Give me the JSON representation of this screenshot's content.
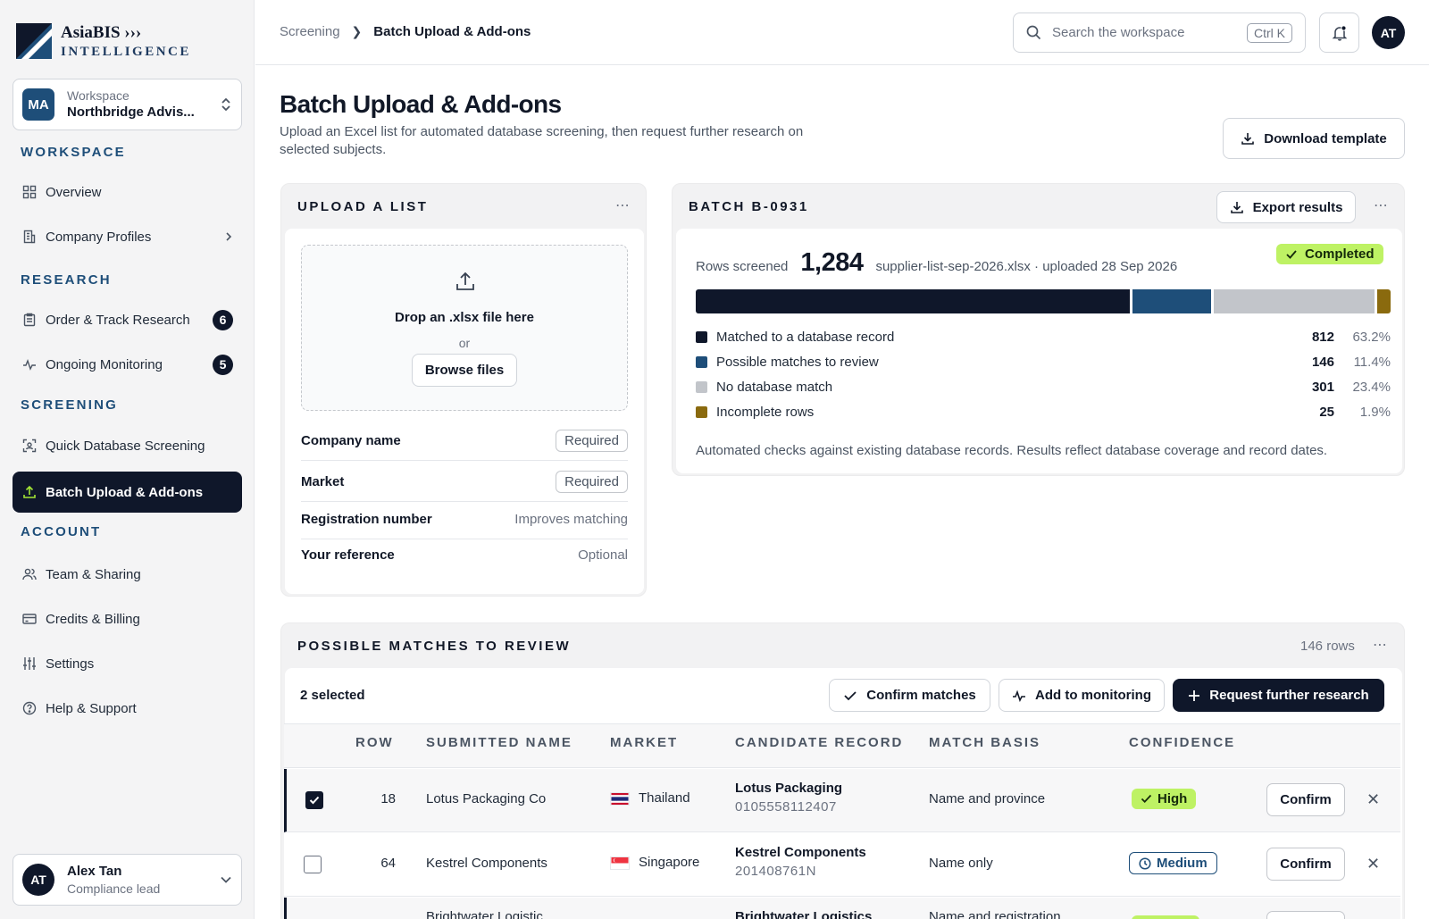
{
  "brand": {
    "name": "AsiaBIS",
    "chevrons": "›››",
    "sub": "INTELLIGENCE",
    "primary": "#0f172a",
    "accent": "#1e4e79",
    "lime": "#bef264"
  },
  "workspace": {
    "initials": "MA",
    "label": "Workspace",
    "name": "Northbridge Advis..."
  },
  "sidebar": {
    "sections": [
      "WORKSPACE",
      "RESEARCH",
      "SCREENING",
      "ACCOUNT"
    ],
    "items": [
      {
        "label": "Overview",
        "icon": "grid-icon"
      },
      {
        "label": "Company Profiles",
        "icon": "building-icon"
      },
      {
        "label": "Order & Track Research",
        "icon": "clipboard-icon",
        "badge": "6"
      },
      {
        "label": "Ongoing Monitoring",
        "icon": "activity-icon",
        "badge": "5"
      },
      {
        "label": "Quick Database Screening",
        "icon": "scan-icon"
      },
      {
        "label": "Batch Upload & Add-ons",
        "icon": "upload-icon",
        "active": true
      },
      {
        "label": "Team & Sharing",
        "icon": "users-icon"
      },
      {
        "label": "Credits & Billing",
        "icon": "card-icon"
      },
      {
        "label": "Settings",
        "icon": "sliders-icon"
      },
      {
        "label": "Help & Support",
        "icon": "help-icon"
      }
    ]
  },
  "user": {
    "initials": "AT",
    "name": "Alex Tan",
    "role": "Compliance lead"
  },
  "topbar": {
    "crumb_parent": "Screening",
    "crumb_current": "Batch Upload & Add-ons",
    "search_placeholder": "Search the workspace",
    "search_shortcut": "Ctrl K",
    "avatar": "AT"
  },
  "page": {
    "title": "Batch Upload & Add-ons",
    "subtitle": "Upload an Excel list for automated database screening, then request further research on selected subjects.",
    "download_label": "Download template"
  },
  "upload": {
    "title": "UPLOAD A LIST",
    "drop_text": "Drop an .xlsx file here",
    "or": "or",
    "browse_label": "Browse files",
    "fields": [
      {
        "name": "Company name",
        "note": "Required",
        "pill": true
      },
      {
        "name": "Market",
        "note": "Required",
        "pill": true
      },
      {
        "name": "Registration number",
        "note": "Improves matching",
        "pill": false
      },
      {
        "name": "Your reference",
        "note": "Optional",
        "pill": false
      }
    ]
  },
  "batch": {
    "title": "BATCH B-0931",
    "export_label": "Export results",
    "rows_label": "Rows screened",
    "rows_value": "1,284",
    "file_info": "supplier-list-sep-2026.xlsx · uploaded 28 Sep 2026",
    "status": "Completed",
    "breakdown": [
      {
        "label": "Matched to a database record",
        "count": "812",
        "pct": "63.2%",
        "share": 63.2,
        "color": "#0f172a"
      },
      {
        "label": "Possible matches to review",
        "count": "146",
        "pct": "11.4%",
        "share": 11.4,
        "color": "#1e4e79"
      },
      {
        "label": "No database match",
        "count": "301",
        "pct": "23.4%",
        "share": 23.4,
        "color": "#c2c5ca"
      },
      {
        "label": "Incomplete rows",
        "count": "25",
        "pct": "1.9%",
        "share": 1.9,
        "color": "#8a6a0e"
      }
    ],
    "footnote": "Automated checks against existing database records. Results reflect database coverage and record dates."
  },
  "review": {
    "title": "POSSIBLE MATCHES TO REVIEW",
    "row_count": "146 rows",
    "selected": "2 selected",
    "confirm_label": "Confirm matches",
    "monitor_label": "Add to monitoring",
    "request_label": "Request further research",
    "columns": [
      "ROW",
      "SUBMITTED NAME",
      "MARKET",
      "CANDIDATE RECORD",
      "MATCH BASIS",
      "CONFIDENCE"
    ],
    "rows": [
      {
        "row": "18",
        "submitted": "Lotus Packaging Co",
        "market": "Thailand",
        "flag": "thailand-flag",
        "cand_name": "Lotus Packaging",
        "cand_id": "0105558112407",
        "basis": "Name and province",
        "confidence": "High",
        "level": "high",
        "selected": true,
        "action": "Confirm"
      },
      {
        "row": "64",
        "submitted": "Kestrel Components",
        "market": "Singapore",
        "flag": "singapore-flag",
        "cand_name": "Kestrel Components",
        "cand_id": "201408761N",
        "basis": "Name only",
        "confidence": "Medium",
        "level": "medium",
        "selected": false,
        "action": "Confirm"
      },
      {
        "row": "",
        "submitted": "Brightwater Logistic",
        "market": "",
        "flag": "",
        "cand_name": "Brightwater Logistics",
        "cand_id": "",
        "basis": "Name and registration",
        "confidence": "",
        "level": "high",
        "selected": true,
        "action": ""
      }
    ]
  }
}
